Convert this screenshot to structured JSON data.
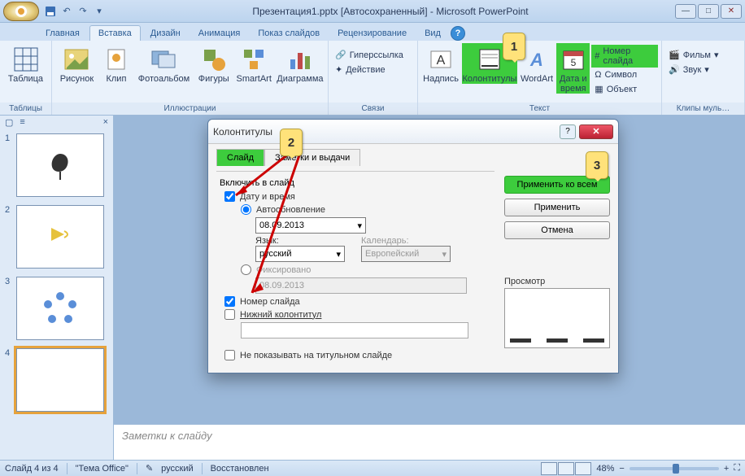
{
  "title": "Презентация1.pptx [Автосохраненный] - Microsoft PowerPoint",
  "tabs": [
    "Главная",
    "Вставка",
    "Дизайн",
    "Анимация",
    "Показ слайдов",
    "Рецензирование",
    "Вид"
  ],
  "activeTab": 1,
  "ribbon": {
    "groups": {
      "tables": {
        "label": "Таблицы",
        "table": "Таблица"
      },
      "illust": {
        "label": "Иллюстрации",
        "image": "Рисунок",
        "clip": "Клип",
        "album": "Фотоальбом",
        "shapes": "Фигуры",
        "smartart": "SmartArt",
        "chart": "Диаграмма"
      },
      "links": {
        "label": "Связи",
        "hyperlink": "Гиперссылка",
        "action": "Действие"
      },
      "text": {
        "label": "Текст",
        "textbox": "Надпись",
        "headerfooter": "Колонтитулы",
        "wordart": "WordArt",
        "datetime": "Дата и время",
        "slidenum": "Номер слайда",
        "symbol": "Символ",
        "object": "Объект"
      },
      "media": {
        "label": "Клипы муль…",
        "movie": "Фильм",
        "sound": "Звук"
      }
    }
  },
  "dialog": {
    "title": "Колонтитулы",
    "tab_slide": "Слайд",
    "tab_notes": "Заметки и выдачи",
    "include": "Включить в слайд",
    "datetime": "Дату и время",
    "autoupdate": "Автообновление",
    "date_value": "08.09.2013",
    "lang_label": "Язык:",
    "lang_value": "русский",
    "cal_label": "Календарь:",
    "cal_value": "Европейский",
    "fixed": "Фиксировано",
    "fixed_value": "08.09.2013",
    "slidenum": "Номер слайда",
    "footer": "Нижний колонтитул",
    "dontshow": "Не показывать на титульном слайде",
    "apply_all": "Применить ко всем",
    "apply": "Применить",
    "cancel": "Отмена",
    "preview": "Просмотр"
  },
  "callouts": {
    "c1": "1",
    "c2": "2",
    "c3": "3"
  },
  "notes_placeholder": "Заметки к слайду",
  "status": {
    "slide": "Слайд 4 из 4",
    "theme": "\"Тема Office\"",
    "lang": "русский",
    "saved": "Восстановлен",
    "zoom": "48%"
  }
}
